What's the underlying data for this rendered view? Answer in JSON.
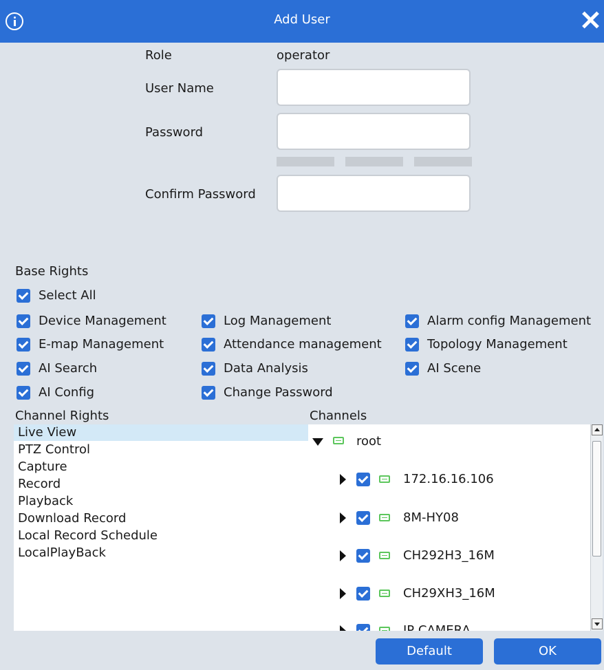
{
  "dialog": {
    "title": "Add User"
  },
  "form": {
    "role_label": "Role",
    "role_value": "operator",
    "username_label": "User Name",
    "username_value": "",
    "password_label": "Password",
    "password_value": "",
    "confirm_label": "Confirm Password",
    "confirm_value": ""
  },
  "base_rights": {
    "heading": "Base Rights",
    "select_all": {
      "label": "Select All",
      "checked": true
    },
    "items": [
      {
        "label": "Device Management",
        "checked": true
      },
      {
        "label": "Log Management",
        "checked": true
      },
      {
        "label": "Alarm config Management",
        "checked": true
      },
      {
        "label": "E-map Management",
        "checked": true
      },
      {
        "label": "Attendance management",
        "checked": true
      },
      {
        "label": "Topology Management",
        "checked": true
      },
      {
        "label": "AI Search",
        "checked": true
      },
      {
        "label": "Data Analysis",
        "checked": true
      },
      {
        "label": "AI Scene",
        "checked": true
      },
      {
        "label": "AI Config",
        "checked": true
      },
      {
        "label": "Change Password",
        "checked": true
      }
    ]
  },
  "channel_rights": {
    "heading": "Channel Rights",
    "selected": "Live View",
    "items": [
      "Live View",
      "PTZ Control",
      "Capture",
      "Record",
      "Playback",
      "Download Record",
      "Local Record Schedule",
      "LocalPlayBack"
    ]
  },
  "channels": {
    "heading": "Channels",
    "root": "root",
    "devices": [
      {
        "name": "172.16.16.106",
        "checked": true
      },
      {
        "name": "8M-HY08",
        "checked": true
      },
      {
        "name": "CH292H3_16M",
        "checked": true
      },
      {
        "name": "CH29XH3_16M",
        "checked": true
      },
      {
        "name": "IP CAMERA",
        "checked": true
      }
    ]
  },
  "buttons": {
    "default": "Default",
    "ok": "OK"
  },
  "colors": {
    "accent": "#2b6fd6",
    "background": "#dde3ea",
    "selection": "#d3e9f7",
    "device_icon": "#5cc65c"
  },
  "icons": [
    "info-icon",
    "close-icon",
    "check-icon",
    "device-icon",
    "expand-arrow-icon",
    "collapse-arrow-icon"
  ]
}
